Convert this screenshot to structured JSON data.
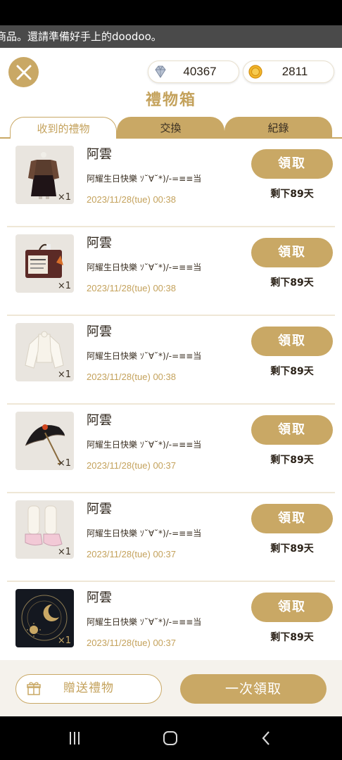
{
  "marquee": {
    "text": "商品。還請準備好手上的doodoo。"
  },
  "header": {
    "title": "禮物箱",
    "close_icon": "close-icon"
  },
  "currency": {
    "diamond": "40367",
    "coin": "2811"
  },
  "tabs": [
    {
      "label": "收到的禮物",
      "active": true
    },
    {
      "label": "交換",
      "active": false
    },
    {
      "label": "紀錄",
      "active": false
    }
  ],
  "gifts": [
    {
      "sender": "阿雲",
      "message": "阿耀生日快樂 ｿ˘∀˘*)/-=≡≡当",
      "date": "2023/11/28(tue) 00:38",
      "qty": "×1",
      "claim": "領取",
      "remain": "剩下89天",
      "item_icon": "outfit-icon"
    },
    {
      "sender": "阿雲",
      "message": "阿耀生日快樂 ｿ˘∀˘*)/-=≡≡当",
      "date": "2023/11/28(tue) 00:38",
      "qty": "×1",
      "claim": "領取",
      "remain": "剩下89天",
      "item_icon": "newspaper-bag-icon"
    },
    {
      "sender": "阿雲",
      "message": "阿耀生日快樂 ｿ˘∀˘*)/-=≡≡当",
      "date": "2023/11/28(tue) 00:38",
      "qty": "×1",
      "claim": "領取",
      "remain": "剩下89天",
      "item_icon": "white-blouse-icon"
    },
    {
      "sender": "阿雲",
      "message": "阿耀生日快樂 ｿ˘∀˘*)/-=≡≡当",
      "date": "2023/11/28(tue) 00:37",
      "qty": "×1",
      "claim": "領取",
      "remain": "剩下89天",
      "item_icon": "umbrella-icon"
    },
    {
      "sender": "阿雲",
      "message": "阿耀生日快樂 ｿ˘∀˘*)/-=≡≡当",
      "date": "2023/11/28(tue) 00:37",
      "qty": "×1",
      "claim": "領取",
      "remain": "剩下89天",
      "item_icon": "shoes-icon"
    },
    {
      "sender": "阿雲",
      "message": "阿耀生日快樂 ｿ˘∀˘*)/-=≡≡当",
      "date": "2023/11/28(tue) 00:37",
      "qty": "×1",
      "claim": "領取",
      "remain": "剩下89天",
      "item_icon": "moon-sun-background-icon"
    }
  ],
  "footer": {
    "send_label": "贈送禮物",
    "claim_all_label": "一次領取"
  },
  "colors": {
    "accent": "#c9a865",
    "accent_text": "#c4a25c"
  }
}
